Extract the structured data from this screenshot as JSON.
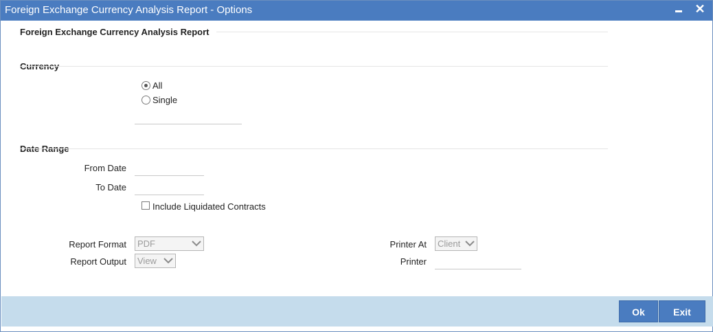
{
  "window": {
    "title": "Foreign Exchange Currency Analysis Report - Options"
  },
  "report_section": {
    "header": "Foreign Exchange Currency Analysis Report"
  },
  "currency": {
    "header": "Currency",
    "options": [
      {
        "label": "All",
        "selected": true
      },
      {
        "label": "Single",
        "selected": false
      }
    ],
    "single_value": ""
  },
  "date_range": {
    "header": "Date Range",
    "from_label": "From Date",
    "from_value": "",
    "to_label": "To Date",
    "to_value": "",
    "include_liquidated_label": "Include Liquidated Contracts",
    "include_liquidated_checked": false
  },
  "report": {
    "format_label": "Report Format",
    "format_value": "PDF",
    "output_label": "Report Output",
    "output_value": "View",
    "printer_at_label": "Printer At",
    "printer_at_value": "Client",
    "printer_label": "Printer",
    "printer_value": ""
  },
  "footer": {
    "ok_label": "Ok",
    "exit_label": "Exit"
  },
  "colors": {
    "titlebar": "#4a7cc0",
    "footer": "#c5dcec",
    "button": "#4a7cc0"
  }
}
